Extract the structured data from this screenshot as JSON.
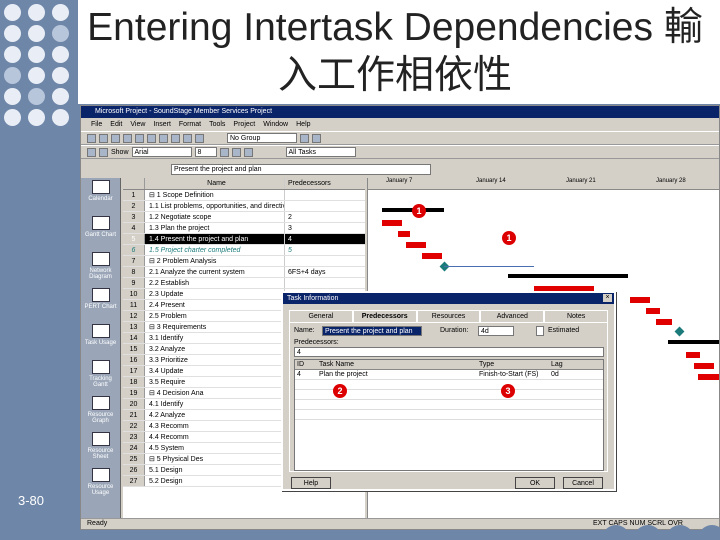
{
  "slide": {
    "title": "Entering Intertask Dependencies 輸入工作相依性",
    "slide_number": "3-80"
  },
  "window": {
    "title": "Microsoft Project - SoundStage Member Services Project",
    "menu": [
      "File",
      "Edit",
      "View",
      "Insert",
      "Format",
      "Tools",
      "Project",
      "Window",
      "Help"
    ],
    "toolbar": {
      "show_label": "Show",
      "font": "Arial",
      "font_size": "8",
      "group": "No Group",
      "filter": "All Tasks",
      "entry_value": "Present the project and plan"
    },
    "status": "Ready",
    "status_indicators": [
      "EXT",
      "CAPS",
      "NUM",
      "SCRL",
      "OVR"
    ]
  },
  "viewbar": [
    "Calendar",
    "Gantt Chart",
    "Network Diagram",
    "PERT Chart",
    "Task Usage",
    "Tracking Gantt",
    "Resource Graph",
    "Resource Sheet",
    "Resource Usage"
  ],
  "grid": {
    "headers": {
      "name": "Name",
      "pred": "Predecessors"
    },
    "rows": [
      {
        "id": "1",
        "name": "⊟ 1 Scope Definition",
        "pred": ""
      },
      {
        "id": "2",
        "name": "1.1 List problems, opportunities, and directives",
        "pred": ""
      },
      {
        "id": "3",
        "name": "1.2 Negotiate scope",
        "pred": "2"
      },
      {
        "id": "4",
        "name": "1.3 Plan the project",
        "pred": "3"
      },
      {
        "id": "5",
        "name": "1.4 Present the project and plan",
        "pred": "4"
      },
      {
        "id": "6",
        "name": "1.5 Project charter completed",
        "pred": "5"
      },
      {
        "id": "7",
        "name": "⊟ 2 Problem Analysis",
        "pred": ""
      },
      {
        "id": "8",
        "name": "2.1 Analyze the current system",
        "pred": "6FS+4 days"
      },
      {
        "id": "9",
        "name": "2.2 Establish",
        "pred": ""
      },
      {
        "id": "10",
        "name": "2.3 Update",
        "pred": ""
      },
      {
        "id": "11",
        "name": "2.4 Present",
        "pred": ""
      },
      {
        "id": "12",
        "name": "2.5 Problem",
        "pred": ""
      },
      {
        "id": "13",
        "name": "⊟ 3 Requirements",
        "pred": ""
      },
      {
        "id": "14",
        "name": "3.1 Identify",
        "pred": ""
      },
      {
        "id": "15",
        "name": "3.2 Analyze",
        "pred": ""
      },
      {
        "id": "16",
        "name": "3.3 Prioritize",
        "pred": ""
      },
      {
        "id": "17",
        "name": "3.4 Update",
        "pred": ""
      },
      {
        "id": "18",
        "name": "3.5 Require",
        "pred": ""
      },
      {
        "id": "19",
        "name": "⊟ 4 Decision Ana",
        "pred": ""
      },
      {
        "id": "20",
        "name": "4.1 Identify",
        "pred": ""
      },
      {
        "id": "21",
        "name": "4.2 Analyze",
        "pred": ""
      },
      {
        "id": "22",
        "name": "4.3 Recomm",
        "pred": ""
      },
      {
        "id": "23",
        "name": "4.4 Recomm",
        "pred": ""
      },
      {
        "id": "24",
        "name": "4.5 System",
        "pred": ""
      },
      {
        "id": "25",
        "name": "⊟ 5 Physical Des",
        "pred": ""
      },
      {
        "id": "26",
        "name": "5.1 Design",
        "pred": ""
      },
      {
        "id": "27",
        "name": "5.2 Design",
        "pred": ""
      }
    ]
  },
  "timescale": {
    "weeks": [
      "January 7",
      "January 14",
      "January 21",
      "January 28"
    ],
    "days": [
      "S",
      "M",
      "T",
      "W",
      "T",
      "F",
      "S",
      "S",
      "M",
      "W",
      "F",
      "S",
      "T",
      "T",
      "S",
      "M",
      "W",
      "F",
      "S",
      "T"
    ]
  },
  "dialog": {
    "title": "Task Information",
    "tabs": [
      "General",
      "Predecessors",
      "Resources",
      "Advanced",
      "Notes"
    ],
    "active_tab": "Predecessors",
    "name_label": "Name:",
    "name_value": "Present the project and plan",
    "duration_label": "Duration:",
    "duration_value": "4d",
    "estimated_label": "Estimated",
    "predecessors_label": "Predecessors:",
    "edit_value": "4",
    "columns": [
      "ID",
      "Task Name",
      "Type",
      "Lag"
    ],
    "rows": [
      {
        "id": "4",
        "name": "Plan the project",
        "type": "Finish-to-Start (FS)",
        "lag": "0d"
      }
    ],
    "help": "Help",
    "ok": "OK",
    "cancel": "Cancel"
  },
  "callouts": [
    "1",
    "1",
    "2",
    "3"
  ],
  "colors": {
    "task_bar": "#e00000",
    "summary_bar": "#000000",
    "milestone": "#1b7a7a",
    "link": "#4a6fb0"
  }
}
